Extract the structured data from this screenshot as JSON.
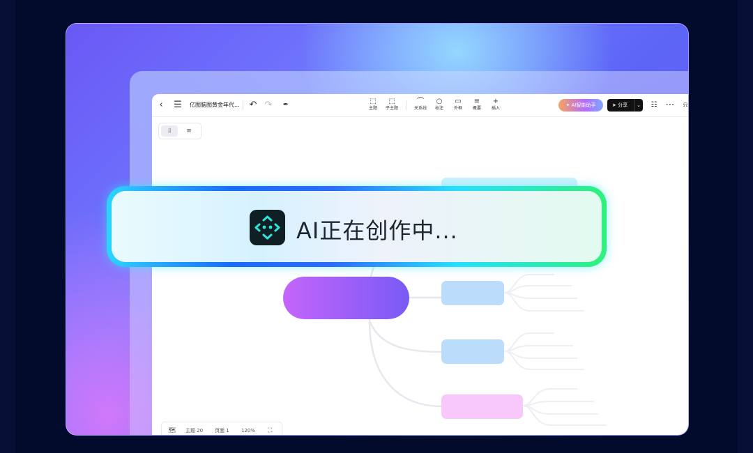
{
  "toolbar": {
    "doc_title": "亿图脑图黄金年代...",
    "tools": [
      {
        "label": "主题",
        "icon": "topic-icon"
      },
      {
        "label": "子主题",
        "icon": "subtopic-icon"
      },
      {
        "label": "关系线",
        "icon": "relation-line-icon"
      },
      {
        "label": "标注",
        "icon": "callout-icon"
      },
      {
        "label": "外框",
        "icon": "boundary-icon"
      },
      {
        "label": "概要",
        "icon": "summary-icon"
      },
      {
        "label": "插入",
        "icon": "plus-icon"
      }
    ],
    "ai_button": "AI智能助手",
    "share_button": "分享"
  },
  "status_bar": {
    "topics": "主题 20",
    "pages": "页面 1",
    "zoom": "120%"
  },
  "banner": {
    "text": "AI正在创作中..."
  },
  "colors": {
    "root_node": "#a460f8",
    "level1_blue": "#bcdcfb",
    "level1_pink": "#f9c8fb",
    "banner_glow": "#2df27a"
  }
}
